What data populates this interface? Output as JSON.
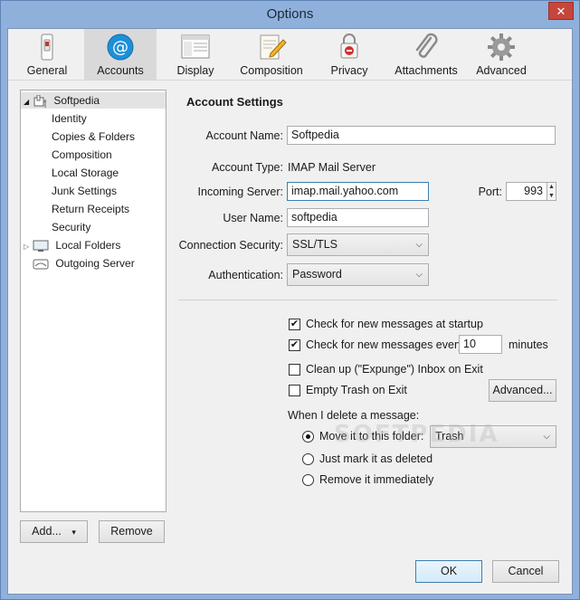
{
  "window": {
    "title": "Options",
    "close_glyph": "✕"
  },
  "toolbar": {
    "items": [
      {
        "label": "General",
        "icon": "switch-icon"
      },
      {
        "label": "Accounts",
        "icon": "at-sign-icon",
        "selected": true
      },
      {
        "label": "Display",
        "icon": "window-icon"
      },
      {
        "label": "Composition",
        "icon": "pen-paper-icon"
      },
      {
        "label": "Privacy",
        "icon": "lock-icon"
      },
      {
        "label": "Attachments",
        "icon": "paperclip-icon"
      },
      {
        "label": "Advanced",
        "icon": "gear-icon"
      }
    ]
  },
  "accounts_tree": {
    "root": "Softpedia",
    "children": [
      "Identity",
      "Copies & Folders",
      "Composition",
      "Local Storage",
      "Junk Settings",
      "Return Receipts",
      "Security"
    ],
    "local_folders": "Local Folders",
    "outgoing": "Outgoing Server"
  },
  "account_buttons": {
    "add": "Add...",
    "add_chevron": "▾",
    "remove": "Remove"
  },
  "settings": {
    "title": "Account Settings",
    "account_name_label": "Account Name:",
    "account_name": "Softpedia",
    "account_type_label": "Account Type:",
    "account_type": "IMAP Mail Server",
    "incoming_server_label": "Incoming Server:",
    "incoming_server": "imap.mail.yahoo.com",
    "port_label": "Port:",
    "port": "993",
    "user_name_label": "User Name:",
    "user_name": "softpedia",
    "connection_security_label": "Connection Security:",
    "connection_security": "SSL/TLS",
    "authentication_label": "Authentication:",
    "authentication": "Password"
  },
  "options": {
    "check_startup": {
      "label": "Check for new messages at startup",
      "checked": true
    },
    "check_every": {
      "label": "Check for new messages every",
      "value": "10",
      "unit": "minutes",
      "checked": true
    },
    "cleanup": {
      "label": "Clean up (\"Expunge\") Inbox on Exit",
      "checked": false
    },
    "empty_trash": {
      "label": "Empty Trash on Exit",
      "checked": false
    },
    "advanced_button": "Advanced...",
    "delete_label": "When I delete a message:",
    "move_to": {
      "label": "Move it to this folder:",
      "selected": true,
      "folder": "Trash"
    },
    "just_mark": {
      "label": "Just mark it as deleted",
      "selected": false
    },
    "remove_immediately": {
      "label": "Remove it immediately",
      "selected": false
    }
  },
  "footer": {
    "ok": "OK",
    "cancel": "Cancel"
  },
  "watermark": "SOFTPEDIA",
  "colors": {
    "accent_blue": "#1e8fd8",
    "title_bar": "#8fb0db"
  }
}
